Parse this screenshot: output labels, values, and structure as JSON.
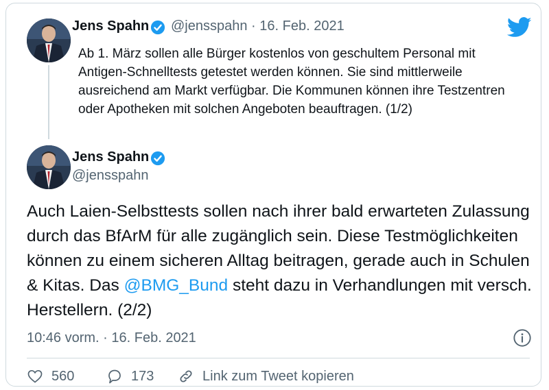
{
  "tweet1": {
    "author_name": "Jens Spahn",
    "handle": "@jensspahn",
    "separator": "·",
    "date": "16. Feb. 2021",
    "text": "Ab 1. März sollen alle Bürger kostenlos von geschultem Personal mit Antigen-Schnelltests getestet werden können. Sie sind mittlerweile ausreichend am Markt verfügbar. Die Kommunen können ihre Testzentren oder Apotheken mit solchen Angeboten beauftragen. (1/2)"
  },
  "tweet2": {
    "author_name": "Jens Spahn",
    "handle": "@jensspahn",
    "text_before_mention": "Auch Laien-Selbsttests sollen nach ihrer bald erwarteten Zulassung durch das BfArM für alle zugänglich sein. Diese Testmöglichkeiten können zu einem sicheren Alltag beitragen, gerade auch in Schulen & Kitas. Das ",
    "mention": "@BMG_Bund",
    "text_after_mention": " steht dazu in Verhandlungen mit versch. Herstellern. (2/2)",
    "timestamp": "10:46 vorm. · 16. Feb. 2021"
  },
  "actions": {
    "like_count": "560",
    "reply_count": "173",
    "copy_link_label": "Link zum Tweet kopieren"
  },
  "icons": {
    "verified": "verified-badge-icon",
    "twitter": "twitter-bird-icon",
    "info": "info-icon",
    "like": "heart-icon",
    "reply": "speech-bubble-icon",
    "link": "link-icon"
  },
  "colors": {
    "accent": "#1d9bf0",
    "text": "#0f1419",
    "secondary": "#536471",
    "border": "#cfd9de"
  }
}
